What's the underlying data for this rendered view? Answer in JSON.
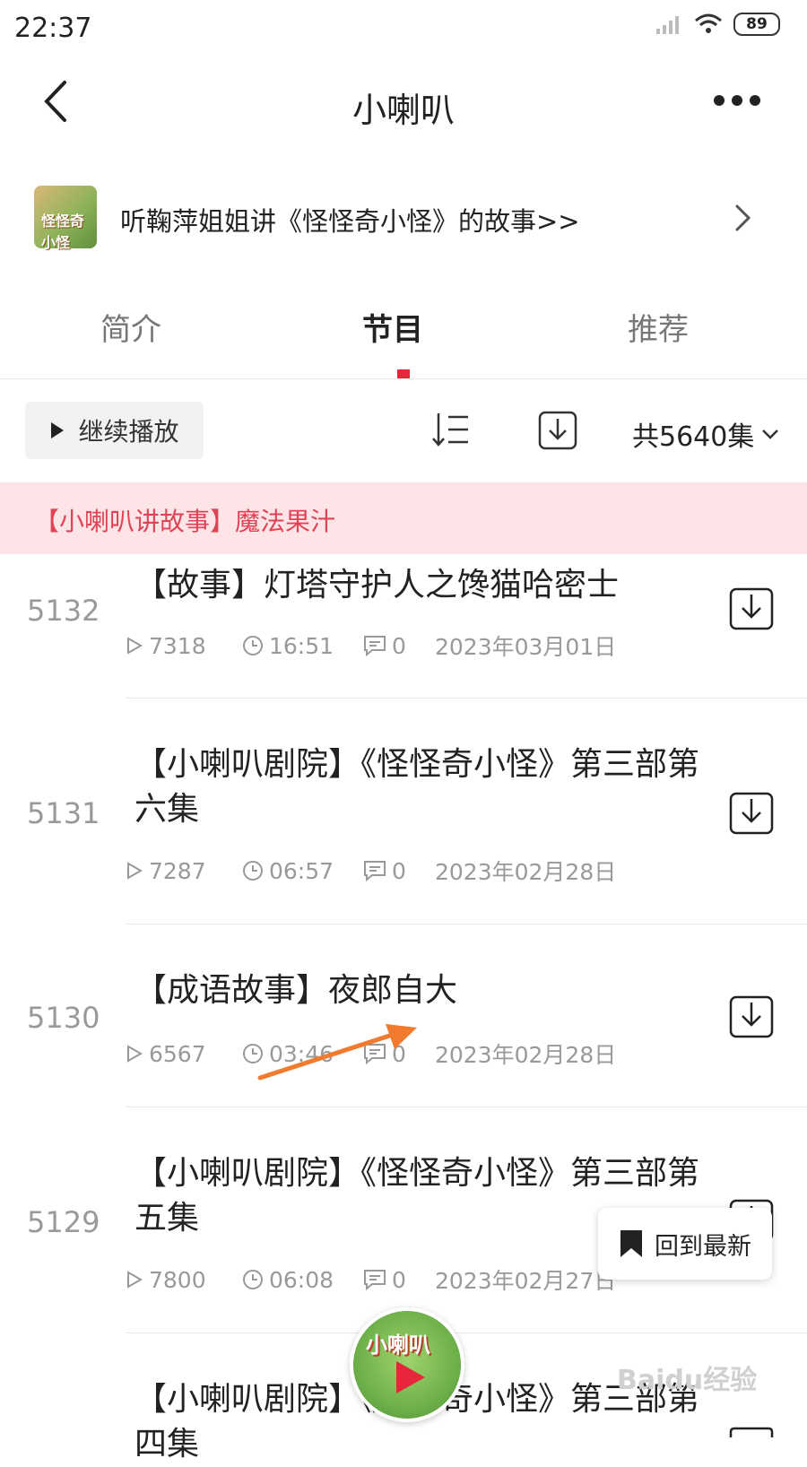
{
  "status_bar": {
    "time": "22:37",
    "battery": "89"
  },
  "header": {
    "title": "小喇叭"
  },
  "banner": {
    "text": "听鞠萍姐姐讲《怪怪奇小怪》的故事>>",
    "thumb_label": "怪怪奇小怪"
  },
  "tabs": [
    {
      "label": "简介",
      "active": false
    },
    {
      "label": "节目",
      "active": true
    },
    {
      "label": "推荐",
      "active": false
    }
  ],
  "toolbar": {
    "continue_label": "继续播放",
    "episode_count": "共5640集"
  },
  "now_playing": {
    "text": "【小喇叭讲故事】魔法果汁"
  },
  "episodes": [
    {
      "num": "5132",
      "title": "【故事】灯塔守护人之馋猫哈密士",
      "plays": "7318",
      "duration": "16:51",
      "comments": "0",
      "date": "2023年03月01日"
    },
    {
      "num": "5131",
      "title": "【小喇叭剧院】《怪怪奇小怪》第三部第六集",
      "plays": "7287",
      "duration": "06:57",
      "comments": "0",
      "date": "2023年02月28日"
    },
    {
      "num": "5130",
      "title": "【成语故事】夜郎自大",
      "plays": "6567",
      "duration": "03:46",
      "comments": "0",
      "date": "2023年02月28日"
    },
    {
      "num": "5129",
      "title": "【小喇叭剧院】《怪怪奇小怪》第三部第五集",
      "plays": "7800",
      "duration": "06:08",
      "comments": "0",
      "date": "2023年02月27日"
    },
    {
      "num": "",
      "title": "【小喇叭剧院】《怪怪奇小怪》第三部第四集",
      "plays": "",
      "duration": "",
      "comments": "",
      "date": ""
    }
  ],
  "floating": {
    "latest_label": "回到最新"
  },
  "mini_player": {
    "title": "小喇叭"
  },
  "watermark": "Baidu经验",
  "colors": {
    "accent": "#e8263b",
    "highlight_bg": "#fde4e6",
    "highlight_text": "#e04256",
    "annotation_arrow": "#f07a2e"
  }
}
